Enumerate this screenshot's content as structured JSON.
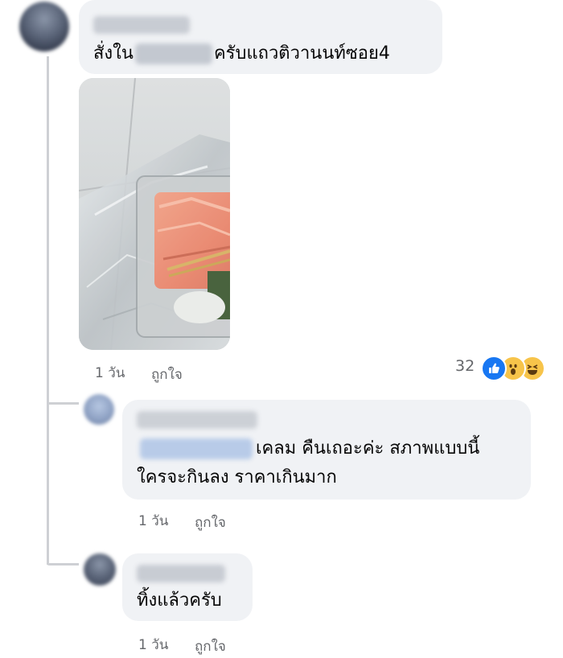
{
  "comments": [
    {
      "text_before": "สั่งใน",
      "text_after": "ครับแถวติวานนท์ซอย4",
      "time": "1 วัน",
      "like_label": "ถูกใจ",
      "reaction_count": "32",
      "reactions": [
        "like-icon",
        "wow-icon",
        "haha-icon"
      ]
    },
    {
      "line1": "เคลม คืนเถอะค่ะ สภาพแบบนี้",
      "line2": "ใครจะกินลง ราคาเกินมาก",
      "time": "1 วัน",
      "like_label": "ถูกใจ"
    },
    {
      "text": "ทิ้งแล้วครับ",
      "time": "1 วัน",
      "like_label": "ถูกใจ"
    }
  ],
  "colors": {
    "bubble": "#f0f2f5",
    "meta_text": "#65676b",
    "like_blue": "#1877f2",
    "reaction_yellow": "#f7c44a",
    "thread_line": "#ced0d4"
  }
}
